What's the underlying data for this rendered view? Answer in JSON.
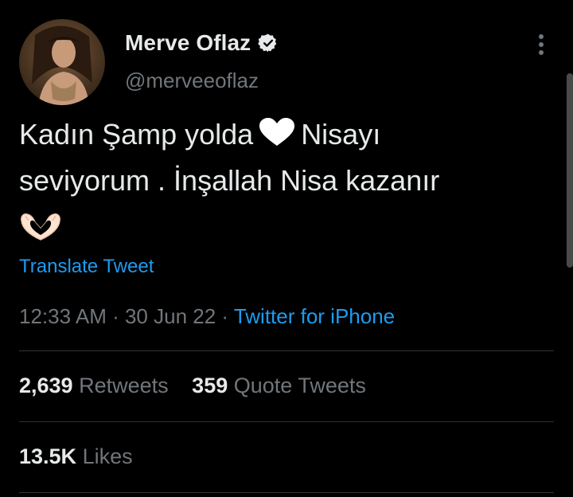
{
  "author": {
    "display_name": "Merve Oflaz",
    "handle": "@merveeoflaz",
    "verified": true
  },
  "tweet": {
    "line1_before_heart": "Kadın Şamp yolda",
    "line1_after_heart": "Nisayı",
    "line2": "seviyorum . İnşallah Nisa kazanır",
    "emojis": [
      "white-heart",
      "heart-hands"
    ]
  },
  "translate_label": "Translate Tweet",
  "meta": {
    "time": "12:33 AM",
    "separator": " · ",
    "date": "30 Jun 22",
    "source": "Twitter for iPhone"
  },
  "stats": {
    "retweets_count": "2,639",
    "retweets_label": "Retweets",
    "quotes_count": "359",
    "quotes_label": "Quote Tweets",
    "likes_count": "13.5K",
    "likes_label": "Likes"
  },
  "colors": {
    "background": "#000000",
    "text": "#e7e9ea",
    "secondary": "#71767b",
    "link": "#1d9bf0",
    "divider": "#2f3336"
  }
}
